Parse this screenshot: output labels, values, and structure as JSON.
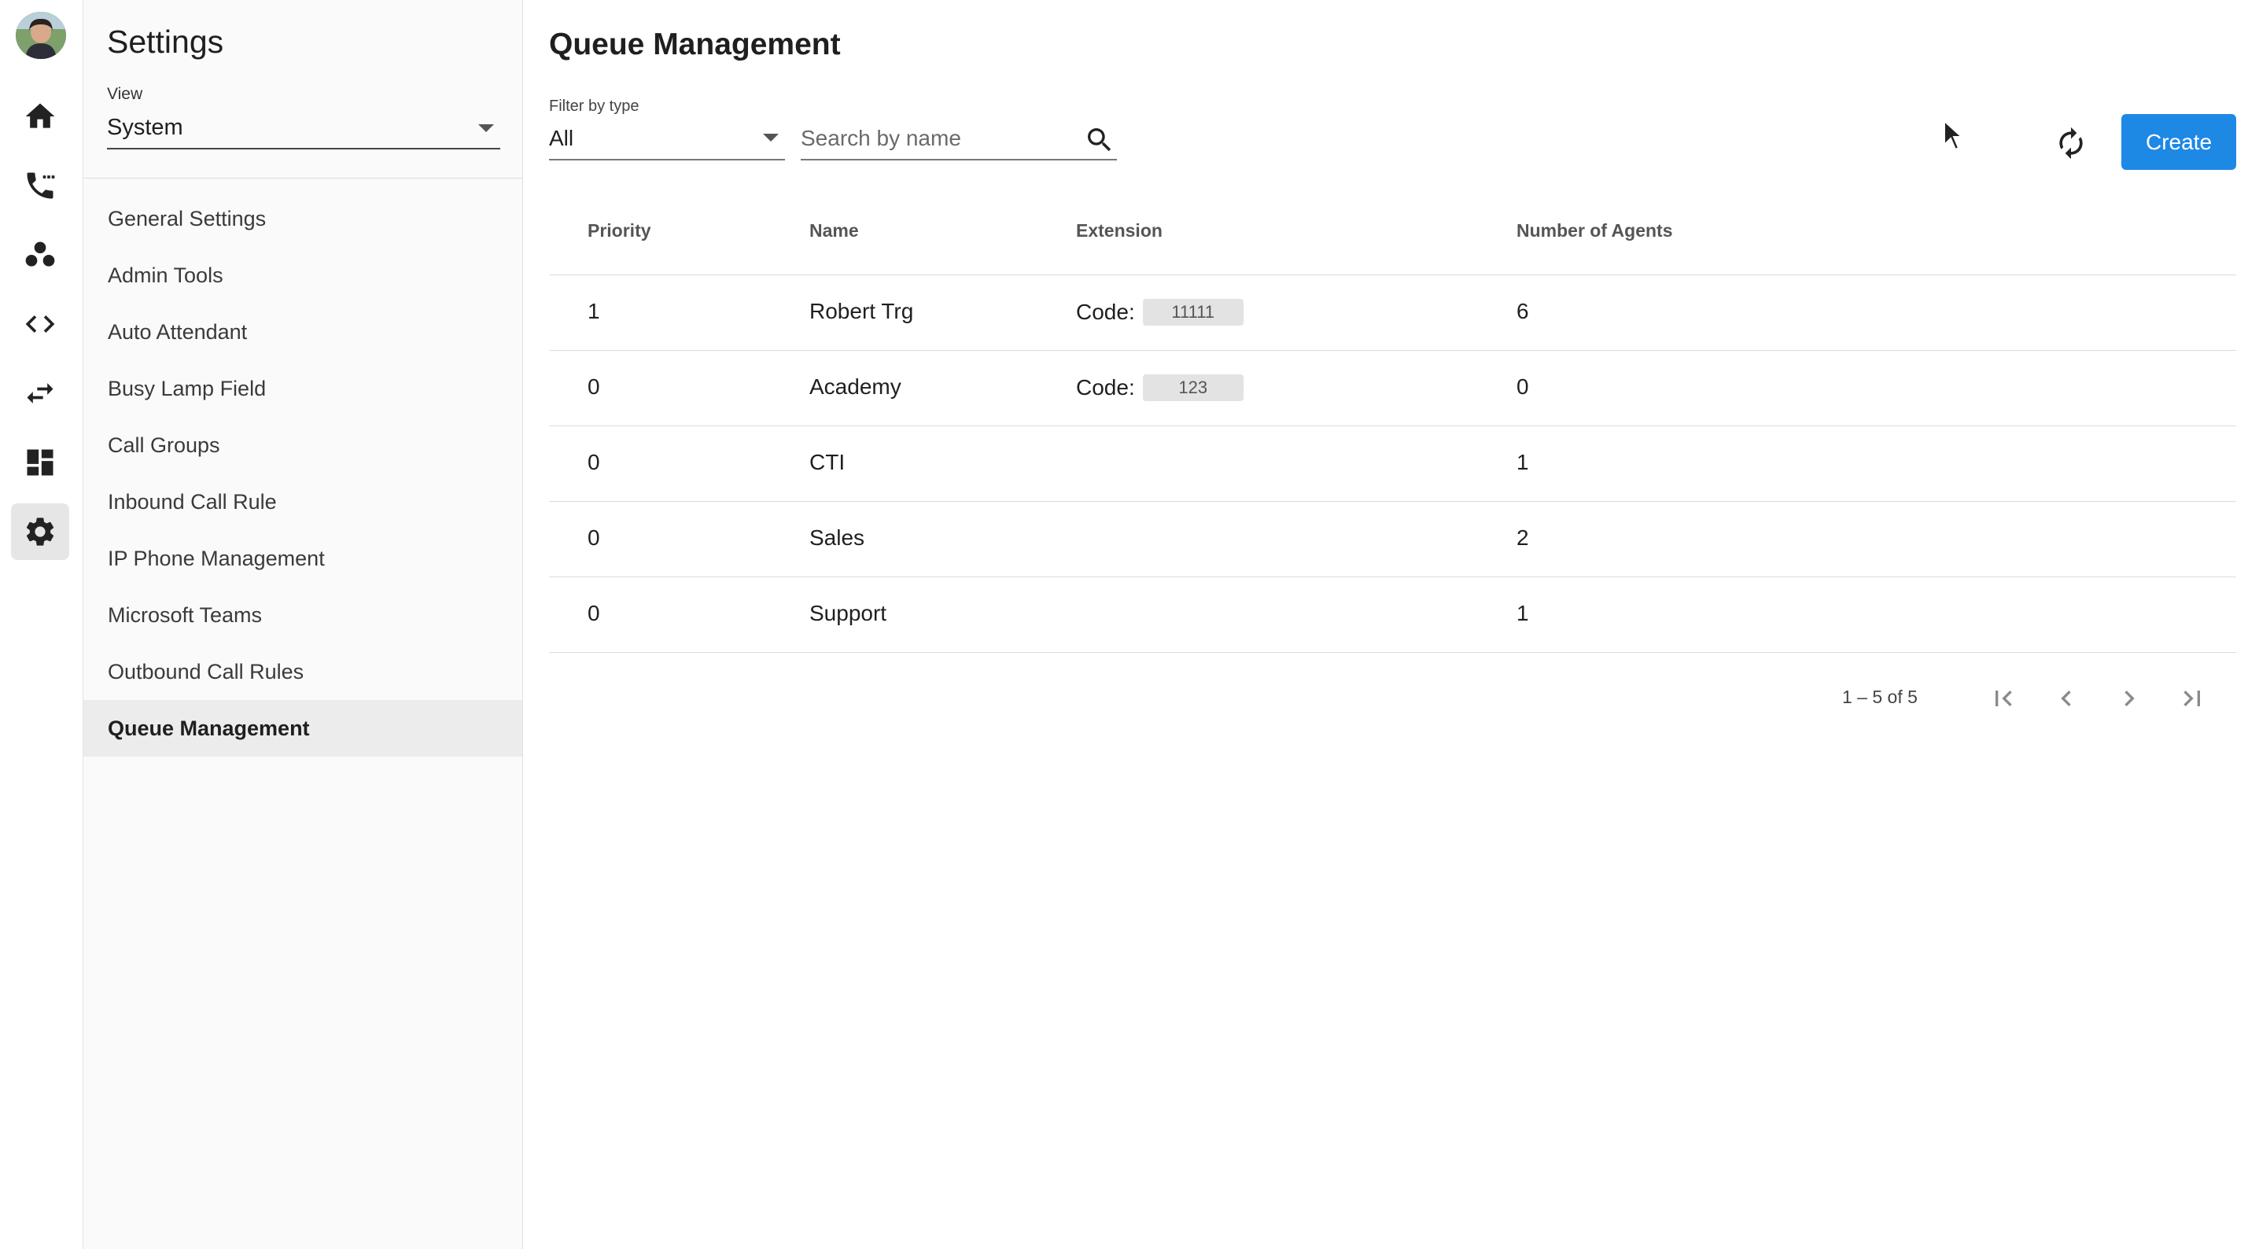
{
  "sidebar": {
    "title": "Settings",
    "view_label": "View",
    "view_value": "System",
    "items": [
      {
        "label": "General Settings"
      },
      {
        "label": "Admin Tools"
      },
      {
        "label": "Auto Attendant"
      },
      {
        "label": "Busy Lamp Field"
      },
      {
        "label": "Call Groups"
      },
      {
        "label": "Inbound Call Rule"
      },
      {
        "label": "IP Phone Management"
      },
      {
        "label": "Microsoft Teams"
      },
      {
        "label": "Outbound Call Rules"
      },
      {
        "label": "Queue Management"
      }
    ],
    "active_item": "Queue Management"
  },
  "rail": {
    "icons": [
      "home-icon",
      "phone-icon",
      "contacts-icon",
      "code-icon",
      "transfer-icon",
      "dashboard-icon",
      "gear-icon"
    ],
    "active_icon": "gear-icon"
  },
  "main": {
    "title": "Queue Management",
    "filter_label": "Filter by type",
    "filter_value": "All",
    "search_placeholder": "Search by name",
    "create_label": "Create",
    "accent_color": "#1e88e5"
  },
  "table": {
    "columns": [
      "Priority",
      "Name",
      "Extension",
      "Number of Agents"
    ],
    "code_label": "Code:",
    "rows": [
      {
        "priority": "1",
        "name": "Robert Trg",
        "code": "11111",
        "agents": "6"
      },
      {
        "priority": "0",
        "name": "Academy",
        "code": "123",
        "agents": "0"
      },
      {
        "priority": "0",
        "name": "CTI",
        "code": "",
        "agents": "1"
      },
      {
        "priority": "0",
        "name": "Sales",
        "code": "",
        "agents": "2"
      },
      {
        "priority": "0",
        "name": "Support",
        "code": "",
        "agents": "1"
      }
    ]
  },
  "pagination": {
    "range": "1 – 5 of 5"
  }
}
